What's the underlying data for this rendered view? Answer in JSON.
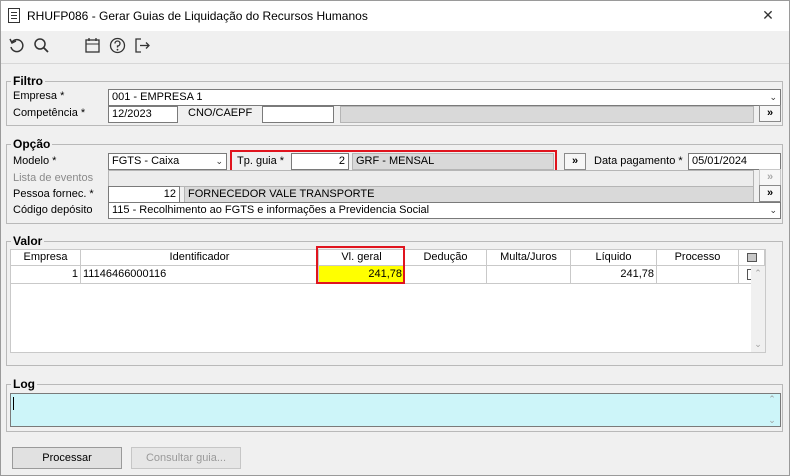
{
  "window": {
    "title": "RHUFP086 - Gerar Guias de Liquidação do Recursos Humanos",
    "close": "✕"
  },
  "filtro": {
    "legend": "Filtro",
    "empresa_label": "Empresa *",
    "empresa_value": "001 - EMPRESA 1",
    "competencia_label": "Competência *",
    "competencia_value": "12/2023",
    "cno_label": "CNO/CAEPF",
    "cno_value": "",
    "cno_desc": "",
    "lookup": "»"
  },
  "opcao": {
    "legend": "Opção",
    "modelo_label": "Modelo *",
    "modelo_value": "FGTS - Caixa",
    "tpguia_label": "Tp. guia *",
    "tpguia_code": "2",
    "tpguia_desc": "GRF - MENSAL",
    "data_pagamento_label": "Data pagamento *",
    "data_pagamento_value": "05/01/2024",
    "lista_eventos_label": "Lista de eventos",
    "lista_eventos_value": "",
    "pessoa_label": "Pessoa fornec. *",
    "pessoa_code": "12",
    "pessoa_desc": "FORNECEDOR VALE TRANSPORTE",
    "deposito_label": "Código depósito",
    "deposito_value": "115 - Recolhimento ao FGTS e informações a Previdencia Social",
    "lookup": "»"
  },
  "valor": {
    "legend": "Valor",
    "columns": [
      "Empresa",
      "Identificador",
      "Vl. geral",
      "Dedução",
      "Multa/Juros",
      "Líquido",
      "Processo"
    ],
    "rows": [
      {
        "empresa": "1",
        "identificador": "11146466000116",
        "vl_geral": "241,78",
        "deducao": "",
        "multa": "",
        "liquido": "241,78",
        "processo": ""
      }
    ],
    "highlight_color": "#ffff00"
  },
  "log": {
    "legend": "Log",
    "value": ""
  },
  "buttons": {
    "processar": "Processar",
    "consultar": "Consultar guia..."
  },
  "colors": {
    "highlight_border": "#e0141e",
    "log_bg": "#cdf5f9"
  }
}
